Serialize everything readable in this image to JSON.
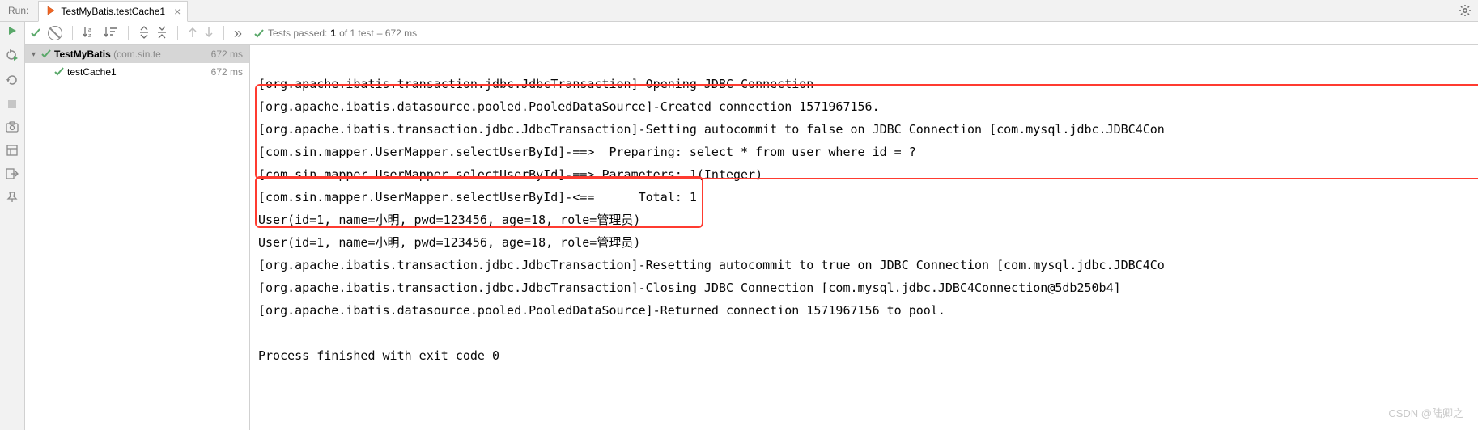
{
  "tabbar": {
    "run_label": "Run:",
    "tab_name": "TestMyBatis.testCache1",
    "close": "×"
  },
  "toolbar": {
    "sort_az": "↓a↓z",
    "expand": "⤢",
    "collapse": "⤡",
    "up": "↑",
    "down": "↓",
    "chev": "»",
    "summary_prefix": "Tests passed:",
    "summary_passed": "1",
    "summary_of": "of 1 test",
    "summary_time": "– 672 ms"
  },
  "tree": {
    "root_name": "TestMyBatis",
    "root_pkg": "(com.sin.te",
    "root_dur": "672 ms",
    "child_name": "testCache1",
    "child_dur": "672 ms"
  },
  "console": {
    "l1": "[org.apache.ibatis.transaction.jdbc.JdbcTransaction]-Opening JDBC Connection",
    "l2": "[org.apache.ibatis.datasource.pooled.PooledDataSource]-Created connection 1571967156.",
    "l3": "[org.apache.ibatis.transaction.jdbc.JdbcTransaction]-Setting autocommit to false on JDBC Connection [com.mysql.jdbc.JDBC4Con",
    "l4": "[com.sin.mapper.UserMapper.selectUserById]-==>  Preparing: select * from user where id = ?",
    "l5": "[com.sin.mapper.UserMapper.selectUserById]-==> Parameters: 1(Integer)",
    "l6": "[com.sin.mapper.UserMapper.selectUserById]-<==      Total: 1",
    "l7": "User(id=1, name=小明, pwd=123456, age=18, role=管理员)",
    "l8": "User(id=1, name=小明, pwd=123456, age=18, role=管理员)",
    "l9": "[org.apache.ibatis.transaction.jdbc.JdbcTransaction]-Resetting autocommit to true on JDBC Connection [com.mysql.jdbc.JDBC4Co",
    "l10": "[org.apache.ibatis.transaction.jdbc.JdbcTransaction]-Closing JDBC Connection [com.mysql.jdbc.JDBC4Connection@5db250b4]",
    "l11": "[org.apache.ibatis.datasource.pooled.PooledDataSource]-Returned connection 1571967156 to pool.",
    "blank": "",
    "exit": "Process finished with exit code 0"
  },
  "watermark": "CSDN @陆卿之"
}
